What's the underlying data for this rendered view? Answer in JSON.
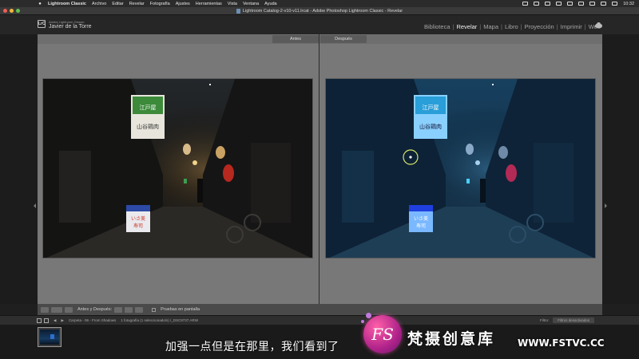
{
  "menubar": {
    "app_name": "Lightroom Classic",
    "items": [
      "Archivo",
      "Editar",
      "Revelar",
      "Fotografía",
      "Ajustes",
      "Herramientas",
      "Vista",
      "Ventana",
      "Ayuda"
    ],
    "clock": "10:32"
  },
  "window": {
    "title": "Lightroom Catalog-2-v10-v11.lrcat - Adobe Photoshop Lightroom Classic - Revelar"
  },
  "identity": {
    "logo_text": "LrC",
    "subtitle": "Adobe Lightroom Classic",
    "user": "Javier de la Torre"
  },
  "modules": {
    "items": [
      "Biblioteca",
      "Revelar",
      "Mapa",
      "Libro",
      "Proyección",
      "Imprimir",
      "Web"
    ],
    "active": "Revelar"
  },
  "compare": {
    "before_label": "Antes",
    "after_label": "Después"
  },
  "photo_signs": {
    "top_sign_line1": "江戸屋",
    "top_sign_line2": "山谷鶏肉",
    "bottom_sign_line1": "いさ美",
    "bottom_sign_line2": "寿司"
  },
  "toolbar": {
    "mode_label": "Antes y Después:",
    "soft_proof_label": "Pruebas en pantalla"
  },
  "filmbar": {
    "source": "Carpeta - 06 - From Shadows",
    "count": "1 fotografía (1 seleccionado/s) /_DSC9737.ARW",
    "filter_label": "Filtro:",
    "filter_value": "Filtros desactivados"
  },
  "overlay": {
    "subtitle": "加强一点但是在那里，我们看到了",
    "watermark_logo": "FS",
    "watermark_name": "梵摄创意库",
    "watermark_url": "WWW.FSTVC.CC"
  },
  "colors": {
    "accent_blue": "#2d6fd0",
    "workarea_gray": "#787878",
    "watermark_pink": "#d0308f"
  }
}
